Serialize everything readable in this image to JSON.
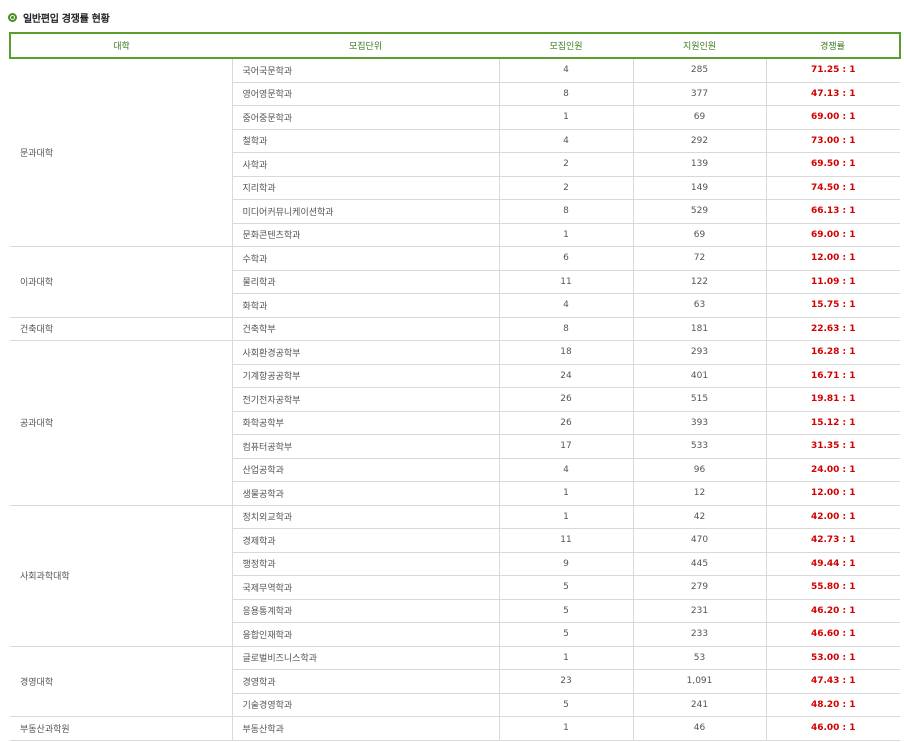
{
  "heading": "일반편입 경쟁률 현황",
  "table": {
    "headers": [
      "대학",
      "모집단위",
      "모집인원",
      "지원인원",
      "경쟁률"
    ],
    "groups": [
      {
        "college": "문과대학",
        "rows": [
          {
            "unit": "국어국문학과",
            "quota": "4",
            "applicants": "285",
            "rate": "71.25 : 1"
          },
          {
            "unit": "영어영문학과",
            "quota": "8",
            "applicants": "377",
            "rate": "47.13 : 1"
          },
          {
            "unit": "중어중문학과",
            "quota": "1",
            "applicants": "69",
            "rate": "69.00 : 1"
          },
          {
            "unit": "철학과",
            "quota": "4",
            "applicants": "292",
            "rate": "73.00 : 1"
          },
          {
            "unit": "사학과",
            "quota": "2",
            "applicants": "139",
            "rate": "69.50 : 1"
          },
          {
            "unit": "지리학과",
            "quota": "2",
            "applicants": "149",
            "rate": "74.50 : 1"
          },
          {
            "unit": "미디어커뮤니케이션학과",
            "quota": "8",
            "applicants": "529",
            "rate": "66.13 : 1"
          },
          {
            "unit": "문화콘텐츠학과",
            "quota": "1",
            "applicants": "69",
            "rate": "69.00 : 1"
          }
        ]
      },
      {
        "college": "이과대학",
        "rows": [
          {
            "unit": "수학과",
            "quota": "6",
            "applicants": "72",
            "rate": "12.00 : 1"
          },
          {
            "unit": "물리학과",
            "quota": "11",
            "applicants": "122",
            "rate": "11.09 : 1"
          },
          {
            "unit": "화학과",
            "quota": "4",
            "applicants": "63",
            "rate": "15.75 : 1"
          }
        ]
      },
      {
        "college": "건축대학",
        "rows": [
          {
            "unit": "건축학부",
            "quota": "8",
            "applicants": "181",
            "rate": "22.63 : 1"
          }
        ]
      },
      {
        "college": "공과대학",
        "rows": [
          {
            "unit": "사회환경공학부",
            "quota": "18",
            "applicants": "293",
            "rate": "16.28 : 1"
          },
          {
            "unit": "기계항공공학부",
            "quota": "24",
            "applicants": "401",
            "rate": "16.71 : 1"
          },
          {
            "unit": "전기전자공학부",
            "quota": "26",
            "applicants": "515",
            "rate": "19.81 : 1"
          },
          {
            "unit": "화학공학부",
            "quota": "26",
            "applicants": "393",
            "rate": "15.12 : 1"
          },
          {
            "unit": "컴퓨터공학부",
            "quota": "17",
            "applicants": "533",
            "rate": "31.35 : 1"
          },
          {
            "unit": "산업공학과",
            "quota": "4",
            "applicants": "96",
            "rate": "24.00 : 1"
          },
          {
            "unit": "생물공학과",
            "quota": "1",
            "applicants": "12",
            "rate": "12.00 : 1"
          }
        ]
      },
      {
        "college": "사회과학대학",
        "rows": [
          {
            "unit": "정치외교학과",
            "quota": "1",
            "applicants": "42",
            "rate": "42.00 : 1"
          },
          {
            "unit": "경제학과",
            "quota": "11",
            "applicants": "470",
            "rate": "42.73 : 1"
          },
          {
            "unit": "행정학과",
            "quota": "9",
            "applicants": "445",
            "rate": "49.44 : 1"
          },
          {
            "unit": "국제무역학과",
            "quota": "5",
            "applicants": "279",
            "rate": "55.80 : 1"
          },
          {
            "unit": "응용통계학과",
            "quota": "5",
            "applicants": "231",
            "rate": "46.20 : 1"
          },
          {
            "unit": "융합인재학과",
            "quota": "5",
            "applicants": "233",
            "rate": "46.60 : 1"
          }
        ]
      },
      {
        "college": "경영대학",
        "rows": [
          {
            "unit": "글로벌비즈니스학과",
            "quota": "1",
            "applicants": "53",
            "rate": "53.00 : 1"
          },
          {
            "unit": "경영학과",
            "quota": "23",
            "applicants": "1,091",
            "rate": "47.43 : 1"
          },
          {
            "unit": "기술경영학과",
            "quota": "5",
            "applicants": "241",
            "rate": "48.20 : 1"
          }
        ]
      },
      {
        "college": "부동산과학원",
        "rows": [
          {
            "unit": "부동산학과",
            "quota": "1",
            "applicants": "46",
            "rate": "46.00 : 1"
          }
        ]
      }
    ]
  }
}
